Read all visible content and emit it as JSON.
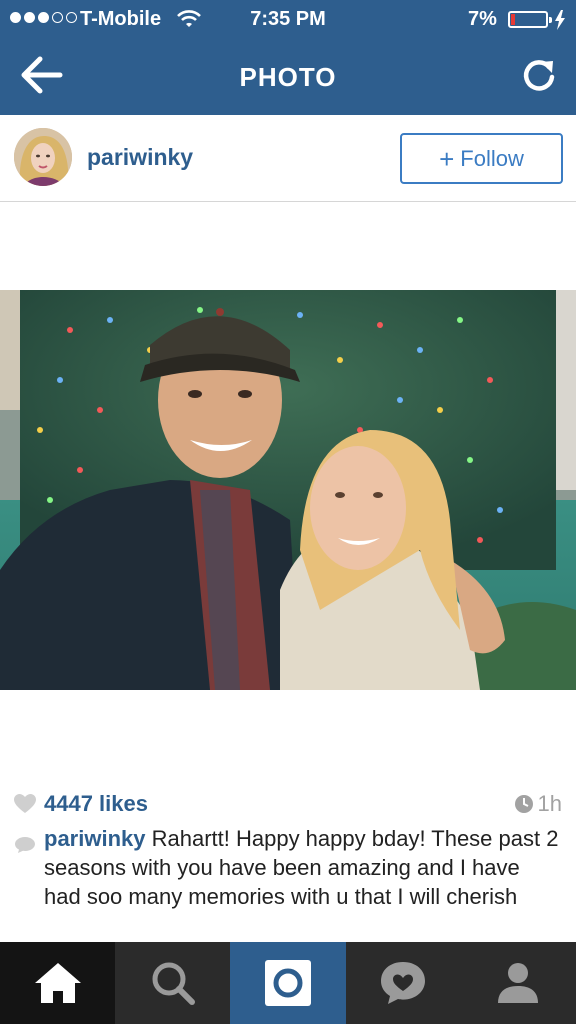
{
  "status": {
    "carrier": "T-Mobile",
    "time": "7:35 PM",
    "battery": "7%",
    "signal_bars": 3,
    "signal_total": 5,
    "battery_level": 0.07
  },
  "nav": {
    "title": "PHOTO",
    "back_icon": "back-arrow-icon",
    "refresh_icon": "refresh-icon"
  },
  "post": {
    "username": "pariwinky",
    "follow_label": "Follow",
    "likes": "4447 likes",
    "time_ago": "1h",
    "caption_user": "pariwinky",
    "caption_text": "Rahartt! Happy happy bday! These past 2 seasons with you have been amazing and I have had soo many memories with u that I will cherish"
  },
  "tabs": [
    {
      "name": "home",
      "icon": "home-icon"
    },
    {
      "name": "explore",
      "icon": "search-icon"
    },
    {
      "name": "camera",
      "icon": "camera-icon"
    },
    {
      "name": "activity",
      "icon": "heart-bubble-icon"
    },
    {
      "name": "profile",
      "icon": "person-icon"
    }
  ],
  "colors": {
    "brand": "#2e5e8e",
    "follow_blue": "#3b7cc3",
    "tabbar": "#2b2b2b"
  }
}
